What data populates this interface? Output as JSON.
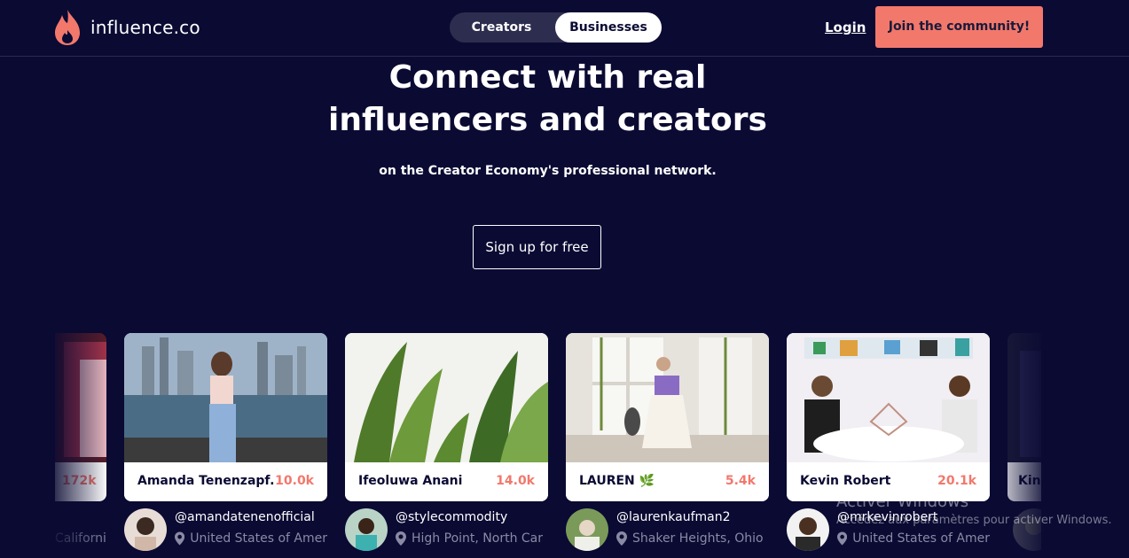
{
  "brand": {
    "name": "influence.co",
    "accent": "#f2786c",
    "background": "#0a0a33"
  },
  "nav": {
    "toggle": {
      "creators": "Creators",
      "businesses": "Businesses",
      "active": "Businesses"
    },
    "login": "Login",
    "join": "Join the community!"
  },
  "hero": {
    "title_line1": "Connect with real",
    "title_line2": "influencers and creators",
    "subtitle": "on the Creator Economy's professional network.",
    "cta": "Sign up for free"
  },
  "carousel": {
    "left_partial": {
      "count": "172k",
      "location": "Californi"
    },
    "cards": [
      {
        "name": "Amanda Tenenzapf…",
        "count": "10.0k",
        "handle": "@amandatenenofficial",
        "location": "United States of Amer",
        "photo_icon": "city-waterfront-photo",
        "location_icon": "map-pin-icon"
      },
      {
        "name": "Ifeoluwa Anani",
        "count": "14.0k",
        "handle": "@stylecommodity",
        "location": "High Point, North Car",
        "photo_icon": "snake-plant-photo",
        "location_icon": "map-pin-icon"
      },
      {
        "name": "LAUREN 🌿",
        "count": "5.4k",
        "handle": "@laurenkaufman2",
        "location": "Shaker Heights, Ohio",
        "photo_icon": "window-cat-photo",
        "location_icon": "map-pin-icon"
      },
      {
        "name": "Kevin Robert",
        "count": "20.1k",
        "handle": "@mrkevinrobert",
        "location": "United States of Amer",
        "photo_icon": "podcast-studio-photo",
        "location_icon": "map-pin-icon"
      }
    ],
    "right_partial": {
      "name": "Kin"
    }
  },
  "watermark": {
    "line1": "Activer Windows",
    "line2": "Accédez aux paramètres pour activer Windows."
  }
}
